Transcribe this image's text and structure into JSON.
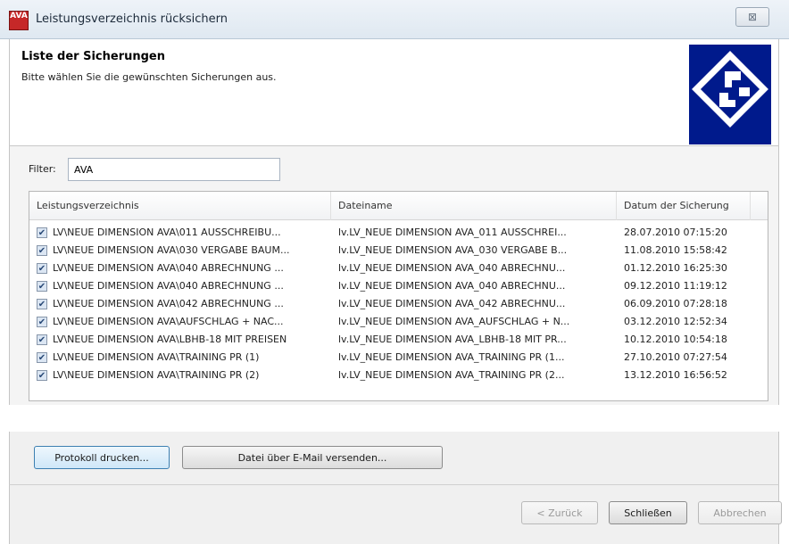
{
  "window": {
    "title": "Leistungsverzeichnis rücksichern",
    "icon_text": "AVA",
    "close_glyph": "⊠"
  },
  "header": {
    "title": "Liste der Sicherungen",
    "subtitle": "Bitte wählen Sie die gewünschten Sicherungen aus."
  },
  "filter": {
    "label": "Filter:",
    "value": "AVA"
  },
  "table": {
    "columns": [
      "Leistungsverzeichnis",
      "Dateiname",
      "Datum der Sicherung"
    ],
    "rows": [
      {
        "checked": true,
        "lv": "LV\\NEUE DIMENSION AVA\\011 AUSSCHREIBU...",
        "file": "lv.LV_NEUE DIMENSION AVA_011 AUSSCHREI...",
        "date": "28.07.2010 07:15:20"
      },
      {
        "checked": true,
        "lv": "LV\\NEUE DIMENSION AVA\\030 VERGABE BAUM...",
        "file": "lv.LV_NEUE DIMENSION AVA_030 VERGABE B...",
        "date": "11.08.2010 15:58:42"
      },
      {
        "checked": true,
        "lv": "LV\\NEUE DIMENSION AVA\\040 ABRECHNUNG ...",
        "file": "lv.LV_NEUE DIMENSION AVA_040 ABRECHNU...",
        "date": "01.12.2010 16:25:30"
      },
      {
        "checked": true,
        "lv": "LV\\NEUE DIMENSION AVA\\040 ABRECHNUNG ...",
        "file": "lv.LV_NEUE DIMENSION AVA_040 ABRECHNU...",
        "date": "09.12.2010 11:19:12"
      },
      {
        "checked": true,
        "lv": "LV\\NEUE DIMENSION AVA\\042 ABRECHNUNG ...",
        "file": "lv.LV_NEUE DIMENSION AVA_042 ABRECHNU...",
        "date": "06.09.2010 07:28:18"
      },
      {
        "checked": true,
        "lv": "LV\\NEUE DIMENSION AVA\\AUFSCHLAG + NAC...",
        "file": "lv.LV_NEUE DIMENSION AVA_AUFSCHLAG + N...",
        "date": "03.12.2010 12:52:34"
      },
      {
        "checked": true,
        "lv": "LV\\NEUE DIMENSION AVA\\LBHB-18 MIT PREISEN",
        "file": "lv.LV_NEUE DIMENSION AVA_LBHB-18 MIT PR...",
        "date": "10.12.2010 10:54:18"
      },
      {
        "checked": true,
        "lv": "LV\\NEUE DIMENSION AVA\\TRAINING PR (1)",
        "file": "lv.LV_NEUE DIMENSION AVA_TRAINING PR (1...",
        "date": "27.10.2010 07:27:54"
      },
      {
        "checked": true,
        "lv": "LV\\NEUE DIMENSION AVA\\TRAINING PR (2)",
        "file": "lv.LV_NEUE DIMENSION AVA_TRAINING PR (2...",
        "date": "13.12.2010 16:56:52"
      }
    ]
  },
  "actions": {
    "print_label": "Protokoll drucken...",
    "mail_label": "Datei über E-Mail versenden..."
  },
  "footer": {
    "back_label": "< Zurück",
    "close_label": "Schließen",
    "cancel_label": "Abbrechen"
  },
  "colors": {
    "logo": "#001a8c",
    "icon_red": "#c62828"
  }
}
